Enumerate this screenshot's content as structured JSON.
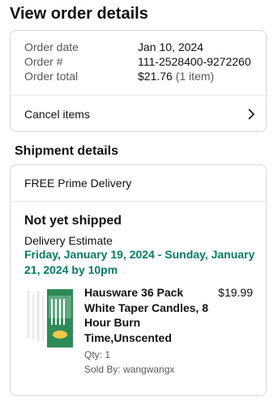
{
  "page": {
    "title": "View order details"
  },
  "order_summary": {
    "rows": [
      {
        "label": "Order date",
        "value": "Jan 10, 2024",
        "extra": ""
      },
      {
        "label": "Order #",
        "value": "111-2528400-9272260",
        "extra": ""
      },
      {
        "label": "Order total",
        "value": "$21.76",
        "extra": "(1 item)"
      }
    ],
    "cancel_label": "Cancel items"
  },
  "shipment": {
    "section_title": "Shipment details",
    "delivery_type": "FREE Prime Delivery",
    "status": "Not yet shipped",
    "estimate_label": "Delivery Estimate",
    "estimate_value": "Friday, January 19, 2024 - Sunday, January 21, 2024 by 10pm",
    "item": {
      "title": "Hausware 36 Pack White Taper Candles, 8 Hour Burn Time,Unscented",
      "price": "$19.99",
      "qty": "Qty: 1",
      "seller": "Sold By: wangwangx",
      "image_icon": "taper-candles-product-image"
    }
  },
  "colors": {
    "estimate_green": "#067d62",
    "border": "#d5d9d9",
    "muted_text": "#565959",
    "box_green": "#2e8b57"
  }
}
